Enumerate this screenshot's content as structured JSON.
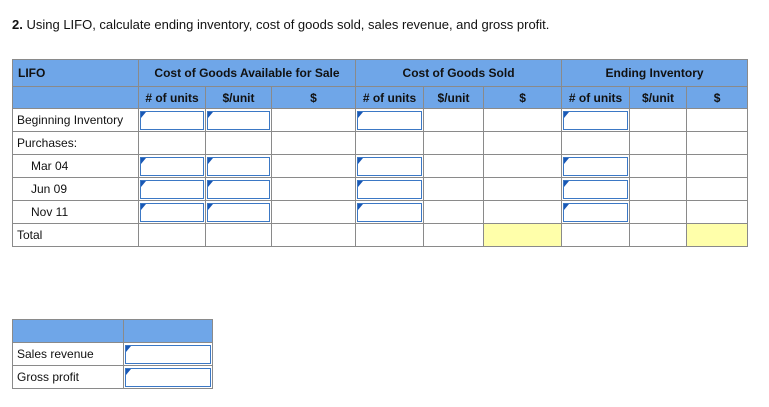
{
  "question": {
    "number": "2.",
    "text": "Using LIFO, calculate ending inventory, cost of goods sold, sales revenue, and gross profit."
  },
  "table": {
    "method_label": "LIFO",
    "group_headers": [
      "Cost of Goods Available for Sale",
      "Cost of Goods Sold",
      "Ending Inventory"
    ],
    "sub_headers": [
      "# of units",
      "$/unit",
      "$"
    ],
    "row_labels": {
      "beginning": "Beginning Inventory",
      "purchases": "Purchases:",
      "mar": "Mar 04",
      "jun": "Jun 09",
      "nov": "Nov 11",
      "total": "Total"
    }
  },
  "summary": {
    "sales_revenue_label": "Sales revenue",
    "gross_profit_label": "Gross profit"
  },
  "colors": {
    "header_blue": "#6fa6e8",
    "highlight_yellow": "#ffffaa",
    "input_border": "#3b78c5"
  }
}
